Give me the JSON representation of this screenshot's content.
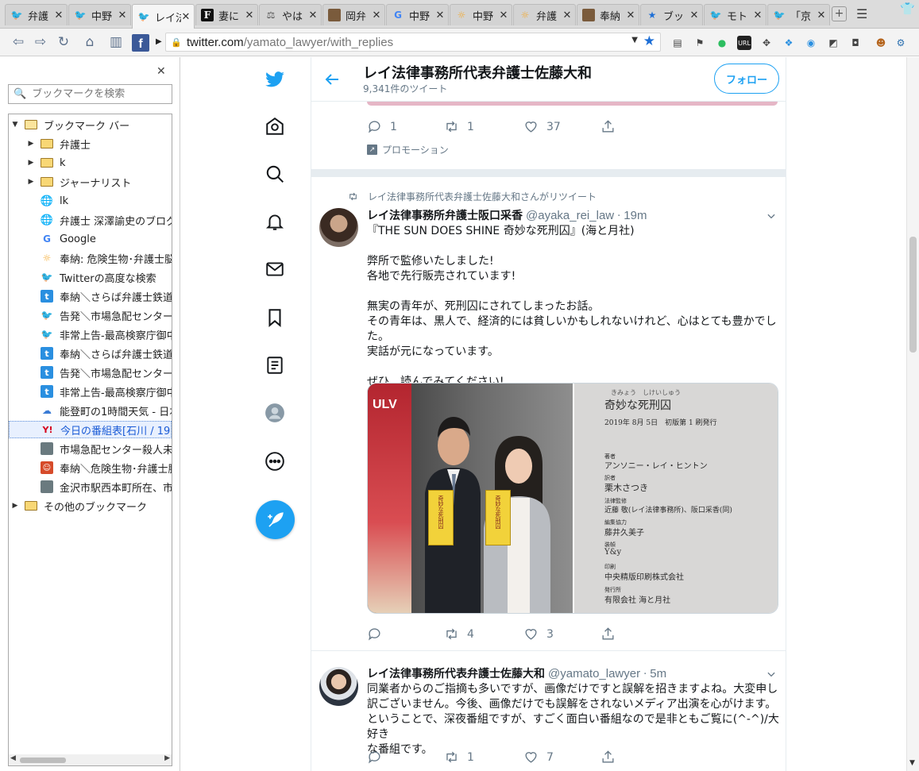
{
  "browser": {
    "tabs": [
      {
        "label": "弁護",
        "icon": "twitter-icon",
        "active": false
      },
      {
        "label": "中野",
        "icon": "twitter-icon",
        "active": false
      },
      {
        "label": "レイ法",
        "icon": "twitter-icon",
        "active": true
      },
      {
        "label": "妻に",
        "icon": "f-logo-icon",
        "active": false
      },
      {
        "label": "やは",
        "icon": "scale-icon",
        "active": false
      },
      {
        "label": "岡弁",
        "icon": "photo-icon",
        "active": false
      },
      {
        "label": "中野",
        "icon": "google-icon",
        "active": false
      },
      {
        "label": "中野",
        "icon": "sun-icon",
        "active": false
      },
      {
        "label": "弁護",
        "icon": "sun-icon",
        "active": false
      },
      {
        "label": "奉納",
        "icon": "photo-icon",
        "active": false
      },
      {
        "label": "ブッ",
        "icon": "star-icon",
        "active": false
      },
      {
        "label": "モト",
        "icon": "twitter-icon",
        "active": false
      },
      {
        "label": "「京",
        "icon": "twitter-icon",
        "active": false
      }
    ],
    "url_host": "twitter.com",
    "url_path": "/yamato_lawyer/with_replies"
  },
  "sidebar": {
    "search_placeholder": "ブックマークを検索",
    "items": [
      {
        "label": "ブックマーク バー",
        "icon": "folder-open-icon",
        "level": 0,
        "arrow": "open",
        "selected": false
      },
      {
        "label": "弁護士",
        "icon": "folder-icon",
        "level": 1,
        "arrow": "closed",
        "selected": false
      },
      {
        "label": "k",
        "icon": "folder-icon",
        "level": 1,
        "arrow": "closed",
        "selected": false
      },
      {
        "label": "ジャーナリスト",
        "icon": "folder-icon",
        "level": 1,
        "arrow": "closed",
        "selected": false
      },
      {
        "label": "lk",
        "icon": "globe-icon",
        "level": 1,
        "arrow": "none",
        "selected": false
      },
      {
        "label": "弁護士 深澤諭史のブログ",
        "icon": "globe-icon",
        "level": 1,
        "arrow": "none",
        "selected": false
      },
      {
        "label": "Google",
        "icon": "google-icon",
        "level": 1,
        "arrow": "none",
        "selected": false
      },
      {
        "label": "奉納: 危険生物･弁護士脳",
        "icon": "sun-icon",
        "level": 1,
        "arrow": "none",
        "selected": false
      },
      {
        "label": "Twitterの高度な検索",
        "icon": "twitter-icon",
        "level": 1,
        "arrow": "none",
        "selected": false
      },
      {
        "label": "奉納＼さらば弁護士鉄道･",
        "icon": "t-icon",
        "level": 1,
        "arrow": "none",
        "selected": false
      },
      {
        "label": "告発＼市場急配センター殺",
        "icon": "twitter-icon",
        "level": 1,
        "arrow": "none",
        "selected": false
      },
      {
        "label": "非常上告-最高検察庁御中",
        "icon": "twitter-icon",
        "level": 1,
        "arrow": "none",
        "selected": false
      },
      {
        "label": "奉納＼さらば弁護士鉄道･",
        "icon": "t-icon",
        "level": 1,
        "arrow": "none",
        "selected": false
      },
      {
        "label": "告発＼市場急配センター殺",
        "icon": "t-icon",
        "level": 1,
        "arrow": "none",
        "selected": false
      },
      {
        "label": "非常上告-最高検察庁御中",
        "icon": "t-icon",
        "level": 1,
        "arrow": "none",
        "selected": false
      },
      {
        "label": "能登町の1時間天気 - 日本",
        "icon": "weather-icon",
        "level": 1,
        "arrow": "none",
        "selected": false
      },
      {
        "label": "今日の番組表[石川 / 19 -",
        "icon": "yahoo-icon",
        "level": 1,
        "arrow": "none",
        "selected": true
      },
      {
        "label": "市場急配センター殺人未遂",
        "icon": "photo-icon",
        "level": 1,
        "arrow": "none",
        "selected": false
      },
      {
        "label": "奉納＼危険生物･弁護士脳",
        "icon": "red-photo-icon",
        "level": 1,
        "arrow": "none",
        "selected": false
      },
      {
        "label": "金沢市駅西本町所在、市場",
        "icon": "photo-icon",
        "level": 1,
        "arrow": "none",
        "selected": false
      },
      {
        "label": "その他のブックマーク",
        "icon": "folder-icon",
        "level": 0,
        "arrow": "closed",
        "selected": false
      }
    ]
  },
  "header": {
    "name": "レイ法律事務所代表弁護士佐藤大和",
    "tweet_count": "9,341件のツイート",
    "follow_label": "フォロー"
  },
  "previous_tweet": {
    "replies": "1",
    "retweets": "1",
    "likes": "37",
    "promotion": "プロモーション"
  },
  "tweets": [
    {
      "retweeted_by": "レイ法律事務所代表弁護士佐藤大和さんがリツイート",
      "name": "レイ法律事務所弁護士阪口采香",
      "handle": "@ayaka_rei_law",
      "time": "19m",
      "lines": [
        "『THE SUN DOES SHINE 奇妙な死刑囚』(海と月社)",
        "",
        "弊所で監修いたしました!",
        "各地で先行販売されています!",
        "",
        "無実の青年が、死刑囚にされてしまったお話。",
        "その青年は、黒人で、経済的には貧しいかもしれないけれど、心はとても豊かでした。",
        "実話が元になっています。",
        "",
        "ぜひ、読んでみてください!"
      ],
      "replies": "",
      "retweets": "4",
      "likes": "3",
      "media": {
        "poster_text": "ULV",
        "book_title_spine": "奇妙な死刑囚",
        "colophon": {
          "ruby": "きみょう　しけいしゅう",
          "title": "奇妙な死刑囚",
          "date": "2019年 8月 5日　初版第 1 刷発行",
          "author_label": "著者",
          "author": "アンソニー・レイ・ヒントン",
          "translator_label": "訳者",
          "translator": "栗木さつき",
          "supervisor_label": "法律監修",
          "supervisor": "近藤 敬(レイ法律事務所)、阪口采香(同)",
          "editor_label": "編集協力",
          "editor": "藤井久美子",
          "design_label": "装幀",
          "design": "Y&y",
          "printer_label": "印刷",
          "printer": "中央精版印刷株式会社",
          "publisher_label": "発行所",
          "publisher": "有限会社 海と月社"
        }
      }
    },
    {
      "retweeted_by": "",
      "name": "レイ法律事務所代表弁護士佐藤大和",
      "handle": "@yamato_lawyer",
      "time": "5m",
      "lines": [
        "同業者からのご指摘も多いですが、画像だけですと誤解を招きますよね。大変申し",
        "訳ございません。今後、画像だけでも誤解をされないメディア出演を心がけます。",
        "ということで、深夜番組ですが、すごく面白い番組なので是非ともご覧に(^-^)/大好き",
        "な番組です。"
      ],
      "replies": "",
      "retweets": "1",
      "likes": "7"
    }
  ],
  "colors": {
    "twitter_blue": "#1da1f2",
    "secondary_text": "#657786",
    "divider": "#e6ecf0"
  }
}
